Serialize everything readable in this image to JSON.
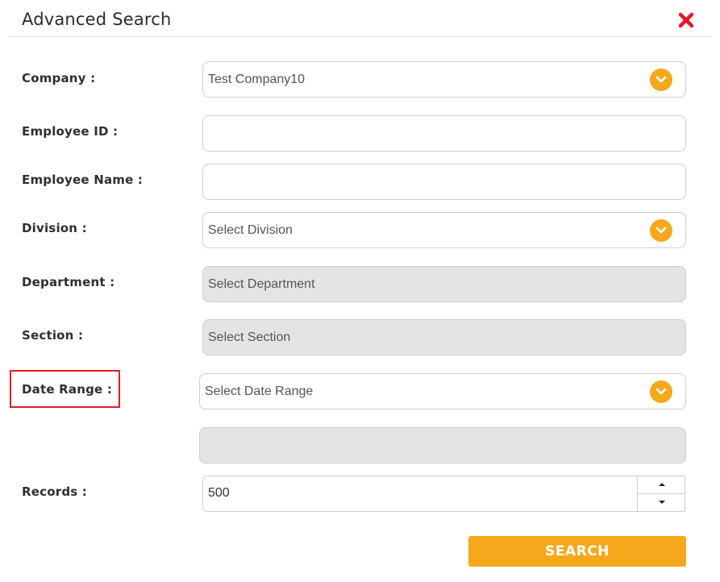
{
  "dialog": {
    "title": "Advanced Search"
  },
  "colors": {
    "accent": "#f5a81c",
    "close": "#e31b23",
    "highlight": "#e31b23",
    "disabled_bg": "#e6e3e3"
  },
  "form": {
    "company": {
      "label": "Company :",
      "value": "Test Company10"
    },
    "employee_id": {
      "label": "Employee ID :",
      "value": ""
    },
    "employee_name": {
      "label": "Employee Name :",
      "value": ""
    },
    "division": {
      "label": "Division :",
      "value": "Select Division"
    },
    "department": {
      "label": "Department :",
      "value": "Select Department"
    },
    "section": {
      "label": "Section :",
      "value": "Select Section"
    },
    "date_range": {
      "label": "Date Range :",
      "value": "Select Date Range"
    },
    "date_value": {
      "value": ""
    },
    "records": {
      "label": "Records :",
      "value": "500"
    }
  },
  "actions": {
    "search_label": "SEARCH"
  },
  "icons": {
    "close": "close-icon",
    "dropdown": "chevron-down-icon",
    "spin_up": "caret-up-icon",
    "spin_down": "caret-down-icon"
  }
}
